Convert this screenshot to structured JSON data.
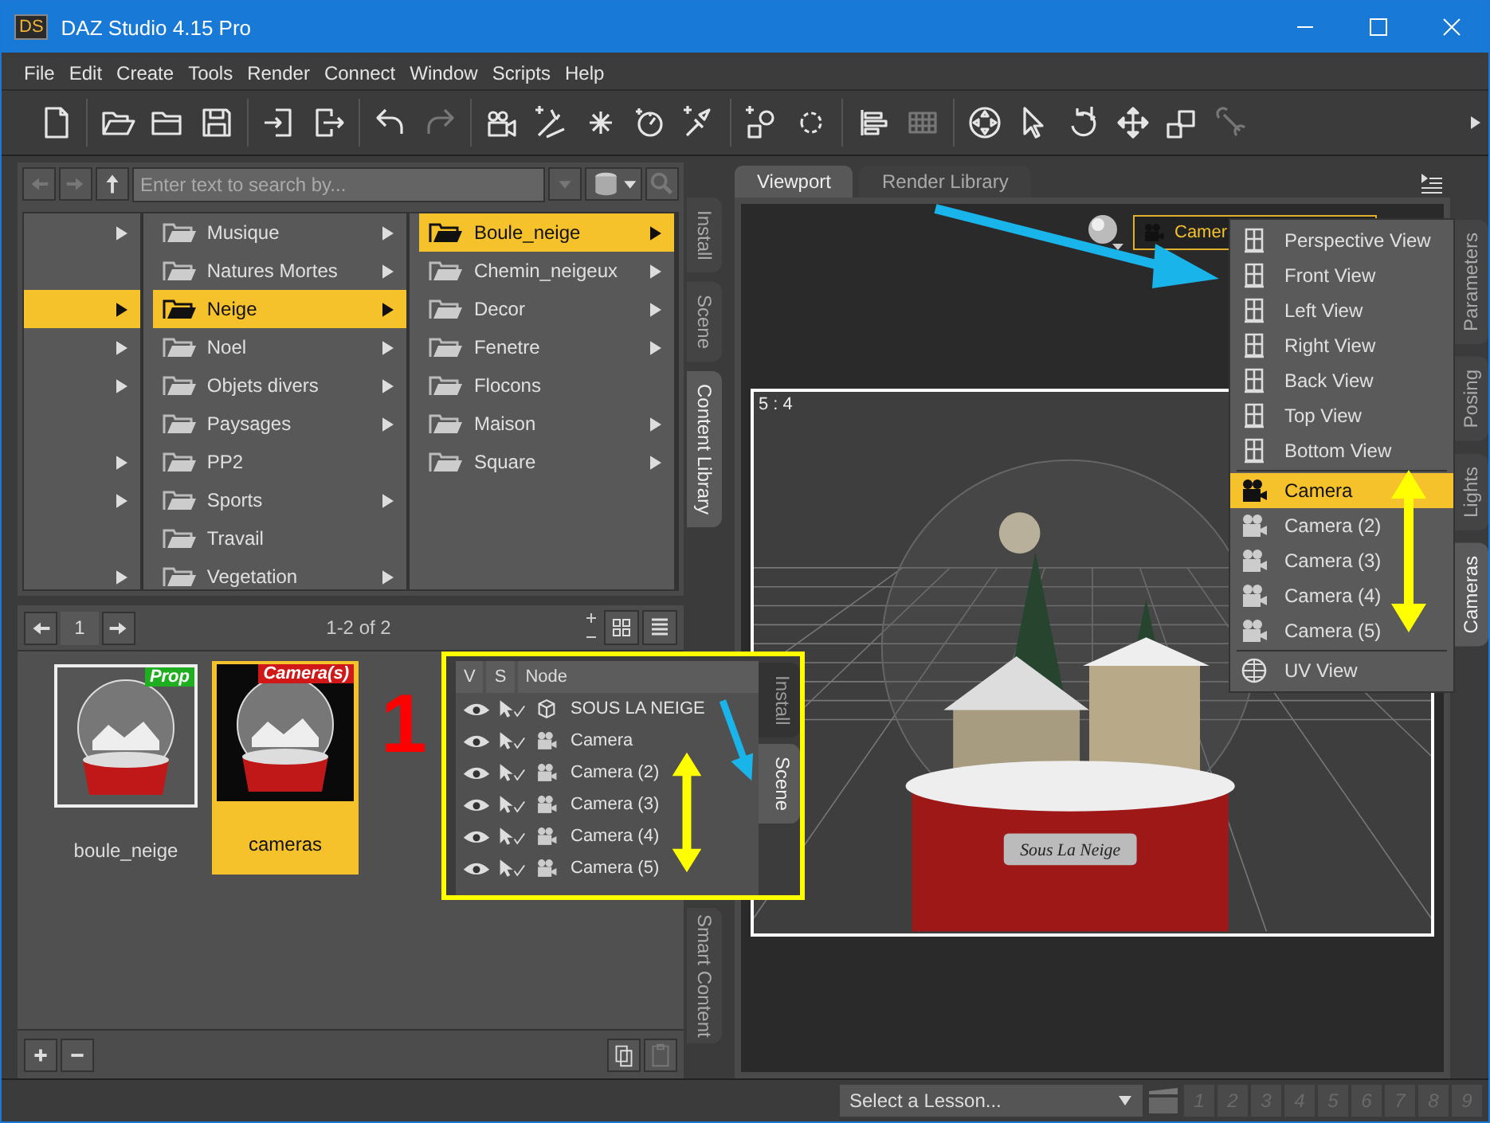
{
  "window": {
    "logo": "DS",
    "title": "DAZ Studio 4.15 Pro"
  },
  "menu": [
    "File",
    "Edit",
    "Create",
    "Tools",
    "Render",
    "Connect",
    "Window",
    "Scripts",
    "Help"
  ],
  "content_library": {
    "search": {
      "placeholder": "Enter text to search by..."
    },
    "column_1": [
      {
        "has_children": true,
        "selected": false
      },
      {
        "has_children": false,
        "selected": false
      },
      {
        "has_children": true,
        "selected": true
      },
      {
        "has_children": true,
        "selected": false
      },
      {
        "has_children": true,
        "selected": false
      },
      {
        "has_children": false,
        "selected": false
      },
      {
        "has_children": true,
        "selected": false
      },
      {
        "has_children": true,
        "selected": false
      },
      {
        "has_children": false,
        "selected": false
      },
      {
        "has_children": true,
        "selected": false
      }
    ],
    "column_2": [
      {
        "label": "Musique",
        "has_children": true,
        "selected": false
      },
      {
        "label": "Natures Mortes",
        "has_children": true,
        "selected": false
      },
      {
        "label": "Neige",
        "has_children": true,
        "selected": true
      },
      {
        "label": "Noel",
        "has_children": true,
        "selected": false
      },
      {
        "label": "Objets divers",
        "has_children": true,
        "selected": false
      },
      {
        "label": "Paysages",
        "has_children": true,
        "selected": false
      },
      {
        "label": "PP2",
        "has_children": false,
        "selected": false
      },
      {
        "label": "Sports",
        "has_children": true,
        "selected": false
      },
      {
        "label": "Travail",
        "has_children": false,
        "selected": false
      },
      {
        "label": "Vegetation",
        "has_children": true,
        "selected": false
      }
    ],
    "column_3": [
      {
        "label": "Boule_neige",
        "has_children": true,
        "selected": true
      },
      {
        "label": "Chemin_neigeux",
        "has_children": true,
        "selected": false
      },
      {
        "label": "Decor",
        "has_children": true,
        "selected": false
      },
      {
        "label": "Fenetre",
        "has_children": true,
        "selected": false
      },
      {
        "label": "Flocons",
        "has_children": false,
        "selected": false
      },
      {
        "label": "Maison",
        "has_children": true,
        "selected": false
      },
      {
        "label": "Square",
        "has_children": true,
        "selected": false
      }
    ],
    "pager": {
      "page": "1",
      "range": "1-2 of 2"
    },
    "assets": [
      {
        "name": "boule_neige",
        "badge": "Prop",
        "color": "#1fae1f",
        "selected": false
      },
      {
        "name": "cameras",
        "badge": "Camera(s)",
        "color": "#d01818",
        "selected": true
      }
    ]
  },
  "left_tabs": [
    {
      "label": "Install",
      "selected": false
    },
    {
      "label": "Scene",
      "selected": false
    },
    {
      "label": "Content Library",
      "selected": true
    },
    {
      "label": "Smart Content",
      "selected": false
    }
  ],
  "annotation_number": "1",
  "scene_inset": {
    "columns": [
      "V",
      "S",
      "Node"
    ],
    "nodes": [
      {
        "name": "SOUS LA NEIGE",
        "kind": "group"
      },
      {
        "name": "Camera",
        "kind": "camera"
      },
      {
        "name": "Camera (2)",
        "kind": "camera"
      },
      {
        "name": "Camera (3)",
        "kind": "camera"
      },
      {
        "name": "Camera (4)",
        "kind": "camera"
      },
      {
        "name": "Camera (5)",
        "kind": "camera"
      }
    ],
    "tabs": [
      {
        "label": "Install",
        "selected": false
      },
      {
        "label": "Scene",
        "selected": true
      }
    ]
  },
  "viewport": {
    "tabs": [
      {
        "label": "Viewport",
        "selected": true
      },
      {
        "label": "Render Library",
        "selected": false
      }
    ],
    "camera_dropdown": {
      "value": "Camer"
    },
    "aspect": "5 : 4",
    "model_label": "Sous La Neige",
    "view_menu": [
      {
        "label": "Perspective View",
        "kind": "view",
        "selected": false
      },
      {
        "label": "Front View",
        "kind": "view",
        "selected": false
      },
      {
        "label": "Left View",
        "kind": "view",
        "selected": false
      },
      {
        "label": "Right View",
        "kind": "view",
        "selected": false
      },
      {
        "label": "Back View",
        "kind": "view",
        "selected": false
      },
      {
        "label": "Top View",
        "kind": "view",
        "selected": false
      },
      {
        "label": "Bottom View",
        "kind": "view",
        "selected": false
      },
      {
        "label": "Camera",
        "kind": "camera",
        "selected": true
      },
      {
        "label": "Camera (2)",
        "kind": "camera",
        "selected": false
      },
      {
        "label": "Camera (3)",
        "kind": "camera",
        "selected": false
      },
      {
        "label": "Camera (4)",
        "kind": "camera",
        "selected": false
      },
      {
        "label": "Camera (5)",
        "kind": "camera",
        "selected": false
      },
      {
        "label": "UV View",
        "kind": "uv",
        "selected": false
      }
    ]
  },
  "right_tabs": [
    {
      "label": "Parameters",
      "selected": false
    },
    {
      "label": "Posing",
      "selected": false
    },
    {
      "label": "Lights",
      "selected": false
    },
    {
      "label": "Cameras",
      "selected": true
    }
  ],
  "status_bar": {
    "lesson": "Select a Lesson...",
    "steps": [
      "1",
      "2",
      "3",
      "4",
      "5",
      "6",
      "7",
      "8",
      "9"
    ]
  }
}
